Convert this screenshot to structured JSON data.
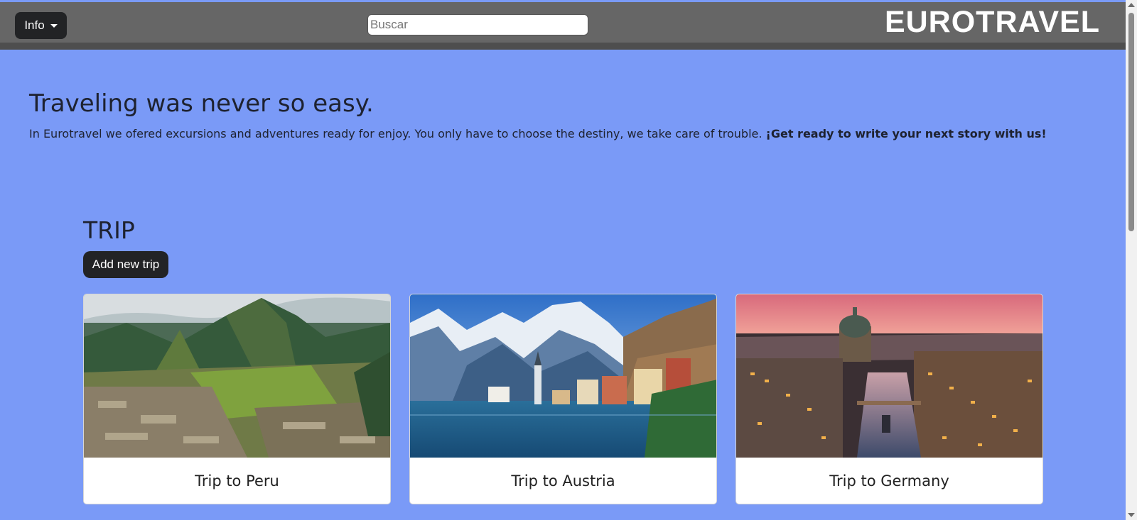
{
  "navbar": {
    "info_label": "Info",
    "search_placeholder": "Buscar",
    "brand": "EUROTRAVEL"
  },
  "hero": {
    "title": "Traveling was never so easy.",
    "text": "In Eurotravel we ofered excursions and adventures ready for enjoy. You only have to choose the destiny, we take care of trouble.",
    "highlight": "¡Get ready to write your next story with us!"
  },
  "trips": {
    "heading": "TRIP",
    "add_label": "Add new trip",
    "cards": [
      {
        "title": "Trip to Peru",
        "image": "machu-picchu-mountain-ruins"
      },
      {
        "title": "Trip to Austria",
        "image": "alpine-lake-village-snowy-mountains"
      },
      {
        "title": "Trip to Germany",
        "image": "berlin-cathedral-river-sunset"
      }
    ]
  },
  "colors": {
    "page_background": "#7a9af7",
    "navbar": "#666666",
    "button": "#222325"
  }
}
